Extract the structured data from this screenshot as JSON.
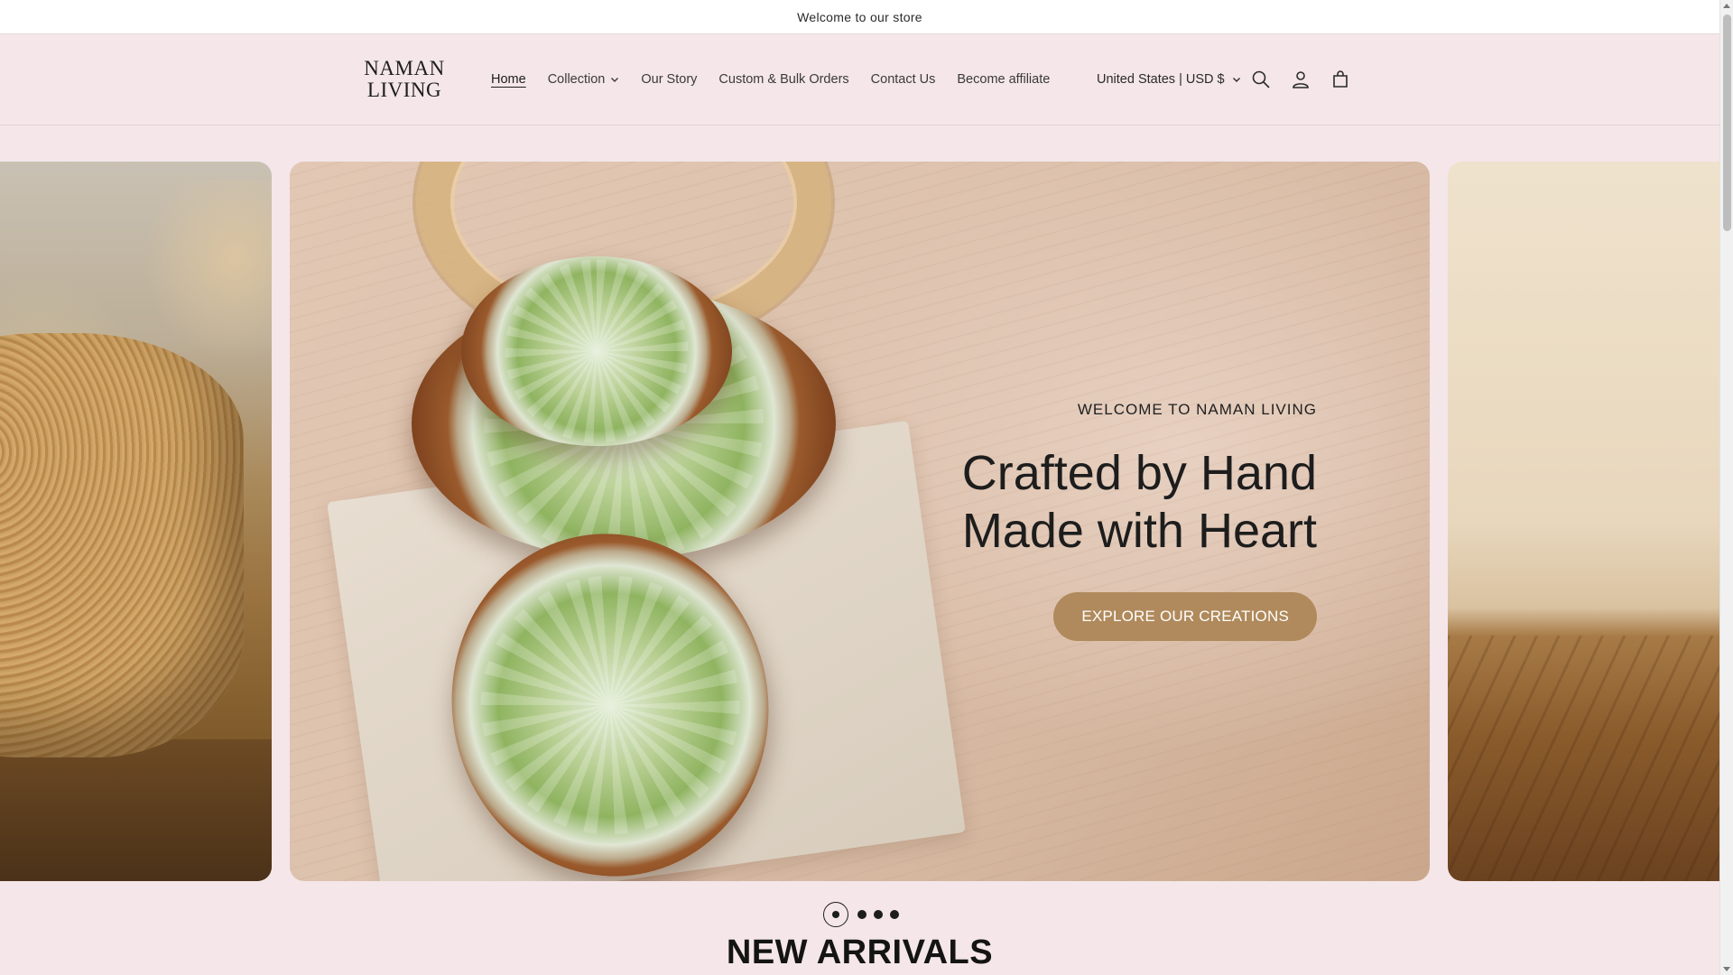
{
  "announcement": {
    "text": "Welcome to our store"
  },
  "header": {
    "logo_line1": "NAMAN",
    "logo_line2": "LIVING",
    "nav": [
      {
        "label": "Home",
        "active": true
      },
      {
        "label": "Collection",
        "has_dropdown": true
      },
      {
        "label": "Our Story"
      },
      {
        "label": "Custom & Bulk Orders"
      },
      {
        "label": "Contact Us"
      },
      {
        "label": "Become affiliate"
      }
    ],
    "country_selector": "United States | USD $",
    "icons": [
      "search-icon",
      "account-icon",
      "cart-icon"
    ]
  },
  "hero": {
    "subheading": "WELCOME TO NAMAN LIVING",
    "title_line1": "Crafted by Hand",
    "title_line2": "Made with Heart",
    "button_label": "EXPLORE OUR CREATIONS",
    "button_color": "#b08a5c"
  },
  "slider": {
    "slide_count": 4,
    "active_index": 0
  },
  "section": {
    "title": "NEW ARRIVALS"
  },
  "colors": {
    "page_background": "#f4e6e9",
    "announcement_background": "#ffffff",
    "text": "#1d1d1d"
  }
}
